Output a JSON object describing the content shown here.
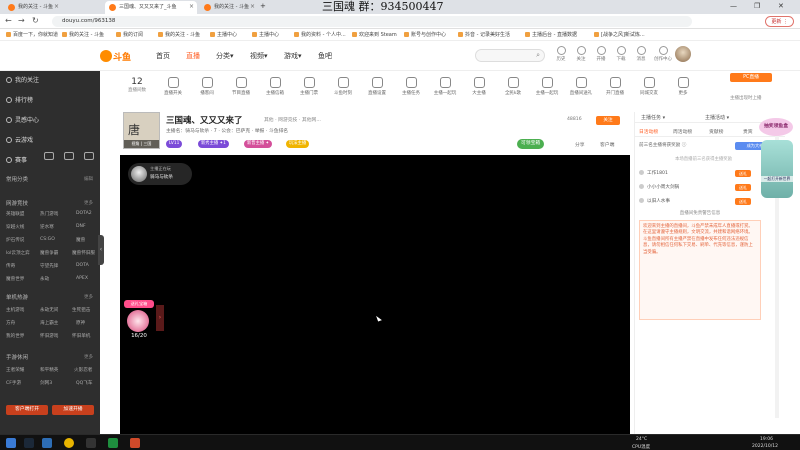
{
  "overlay": {
    "title": "三国魂  群：934500447"
  },
  "browser": {
    "tabs": [
      {
        "label": "我的关注 - 斗鱼",
        "active": false
      },
      {
        "label": "三国魂、又又又来了_斗鱼",
        "active": true
      },
      {
        "label": "我的关注 - 斗鱼",
        "active": false
      }
    ],
    "window_controls": [
      "—",
      "❐",
      "✕"
    ],
    "url": "douyu.com/963138",
    "update_label": "更新 ⋮",
    "bookmarks": [
      "百度一下，你就知道",
      "我的关注 - 斗鱼",
      "我的订阅",
      "我的关注 - 斗鱼",
      "主播中心",
      "主播中心",
      "我的资料 - 个人中...",
      "欢迎来到 Steam",
      "账号与创作中心",
      "抖音 - 记录美好生活",
      "主播后台 - 直播数据",
      "[战争之风]新试炼..."
    ]
  },
  "site": {
    "logo_text": "斗鱼",
    "nav": [
      "首页",
      "直播",
      "分类▾",
      "视频▾",
      "游戏▾",
      "鱼吧"
    ],
    "active_nav": "直播",
    "header_icons": [
      "历史",
      "关注",
      "开播",
      "下载",
      "消息",
      "创作中心"
    ]
  },
  "sidebar": {
    "top_items": [
      "我的关注",
      "排行榜",
      "灵感中心",
      "云游戏",
      "赛事"
    ],
    "sections": [
      {
        "title": "常用分类",
        "more": "编辑",
        "cells": []
      },
      {
        "title": "网游竞技",
        "more": "更多",
        "cells": [
          "英雄联盟",
          "热门游戏",
          "DOTA2",
          "穿越火线",
          "逆水寒",
          "DNF",
          "炉石传说",
          "CS:GO",
          "魔兽",
          "lol云顶之弈",
          "魔兽争霸",
          "魔兽怀旧服",
          "传奇",
          "守望先锋",
          "DOTA",
          "魔兽世界",
          "永劫",
          "APEX"
        ]
      },
      {
        "title": "单机热游",
        "more": "更多",
        "cells": [
          "主机游戏",
          "永劫无间",
          "生死狙击",
          "方舟",
          "海上霸主",
          "原神",
          "我的世界",
          "怀旧游戏",
          "怀旧单机"
        ]
      },
      {
        "title": "手游休闲",
        "more": "更多",
        "cells": [
          "王者荣耀",
          "和平精英",
          "火影忍者",
          "CF手游",
          "剑网3",
          "QQ飞车"
        ]
      }
    ],
    "bottom_buttons": [
      "客户端打开",
      "加速开播"
    ]
  },
  "category_bar": {
    "live_count": "12",
    "live_label": "直播间数",
    "items": [
      "直播开关",
      "播客间",
      "节目直播",
      "主播信箱",
      "主播门票",
      "斗鱼时刻",
      "直播设置",
      "主播任务",
      "主播一起玩",
      "大主播",
      "全民k歌",
      "主播一起玩",
      "直播间送礼",
      "开门直播",
      "同城交友",
      "更多"
    ],
    "pc_button": "PC直播",
    "pc_sub": "主播出现时上播"
  },
  "room": {
    "avatar_text": "唐",
    "avatar_label": "视角 | 三国",
    "title": "三国魂、又又又来了",
    "tag": "其他 · 网游竞技 · 其他网...",
    "meta": "主播名：骑马与砍杀 · 7 · 公会：巴萨克 · 举报 · 斗鱼排名",
    "badges": [
      {
        "label": "LV11",
        "color": "#7b4bd8"
      },
      {
        "label": "新秀主播 ✦1",
        "color": "#7b4bd8"
      },
      {
        "label": "新晋主播 ✦",
        "color": "#d44f9a"
      },
      {
        "label": "玩法主播",
        "color": "#f0b400"
      }
    ],
    "room_number": "48816",
    "follow_label": "关注",
    "green_label": "可领宝箱",
    "tools": [
      "分享",
      "客户端"
    ]
  },
  "video": {
    "streamer_top": "主播正在玩",
    "streamer_name": "骑马与砍杀",
    "gift_badge": "送礼宝箱",
    "gift_count": "16/20"
  },
  "right_panel": {
    "top_tabs": [
      "主播任务 ▾",
      "主播活动 ▾"
    ],
    "tabs": [
      "日活动榜",
      "周活动榜",
      "贡献榜",
      "贵宾"
    ],
    "active_tab": "日活动榜",
    "subheader": "前三名主播将获奖励 ⓘ",
    "sub_button": "成为大神",
    "hint": "本场直播前三名获得主播奖励",
    "rank_rows": [
      {
        "name": "工作1801",
        "button": "送礼"
      },
      {
        "name": "小小小周大剑锅",
        "button": "送礼"
      },
      {
        "name": "以旧人水事",
        "button": "送礼"
      }
    ],
    "notice_head": "直播间免责警告信息",
    "notice": "欢迎来到主播的直播间，斗鱼严禁未成年人直播或打赏。在这里请遵守主播规则，文明交流，共建和谐网络环境。斗鱼直播间所有主播严禁在直播中发布任何违法违规信息，请勿相信任何私下交易、刷单、代充等信息，谨防上当受骗。",
    "event_title": "抽奖领鱼盒",
    "event_caption": "一起打开新世界"
  },
  "taskbar": {
    "temp": "24°C",
    "cpu": "CPU温度",
    "time": "19:06",
    "date": "2022/10/12"
  }
}
